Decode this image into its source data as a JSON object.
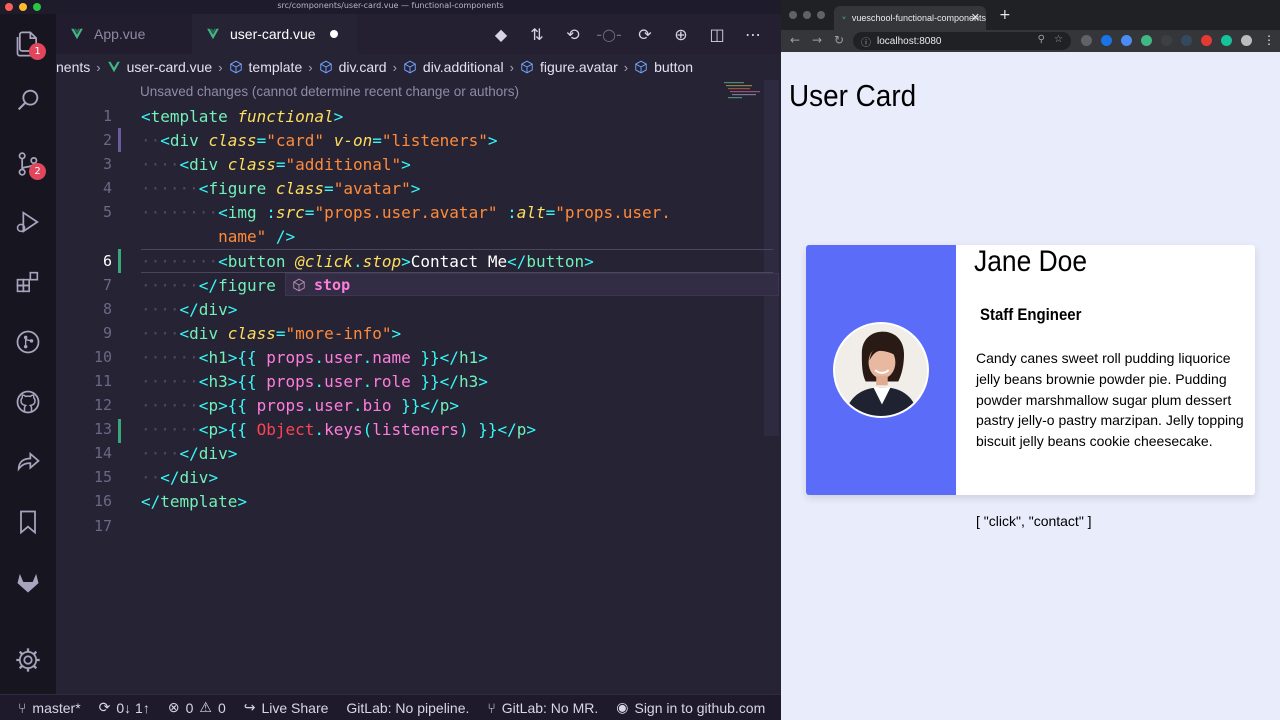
{
  "vscode": {
    "window_title": "src/components/user-card.vue — functional-components",
    "activity_badges": {
      "explorer": "1",
      "source_control": "2"
    },
    "tabs": [
      {
        "label": "App.vue",
        "active": false
      },
      {
        "label": "user-card.vue",
        "active": true,
        "dirty": true
      }
    ],
    "breadcrumb": [
      "nents",
      "user-card.vue",
      "template",
      "div.card",
      "div.additional",
      "figure.avatar",
      "button"
    ],
    "codelens": "Unsaved changes (cannot determine recent change or authors)",
    "line_numbers": [
      "1",
      "2",
      "3",
      "4",
      "5",
      "",
      "6",
      "7",
      "8",
      "9",
      "10",
      "11",
      "12",
      "13",
      "14",
      "15",
      "16",
      "17"
    ],
    "suggestion": "stop",
    "status": {
      "branch": "master*",
      "sync": "0↓ 1↑",
      "errors": "0",
      "warnings": "0",
      "live_share": "Live Share",
      "pipeline": "GitLab: No pipeline.",
      "mr": "GitLab: No MR.",
      "github": "Sign in to github.com"
    }
  },
  "chrome": {
    "tab_title": "vueschool-functional-components",
    "url": "localhost:8080"
  },
  "page": {
    "title": "User Card",
    "user": {
      "name": "Jane Doe",
      "role": "Staff Engineer",
      "bio": "Candy canes sweet roll pudding liquorice jelly beans brownie powder pie. Pudding powder marshmallow sugar plum dessert pastry jelly-o pastry marzipan. Jelly topping biscuit jelly beans cookie cheesecake."
    },
    "listeners": "[ \"click\", \"contact\" ]"
  },
  "colors": {
    "card_accent": "#5b6cf8",
    "editor_bg": "#262335",
    "tag": "#72f1b8",
    "attribute": "#fede5d",
    "string": "#ff8b39"
  },
  "icons": {
    "activity": [
      "files-icon",
      "search-icon",
      "source-control-icon",
      "run-debug-icon",
      "extensions-icon",
      "git-graph-icon",
      "github-icon",
      "live-share-icon",
      "bookmark-icon",
      "gitlab-icon",
      "settings-gear-icon"
    ]
  }
}
